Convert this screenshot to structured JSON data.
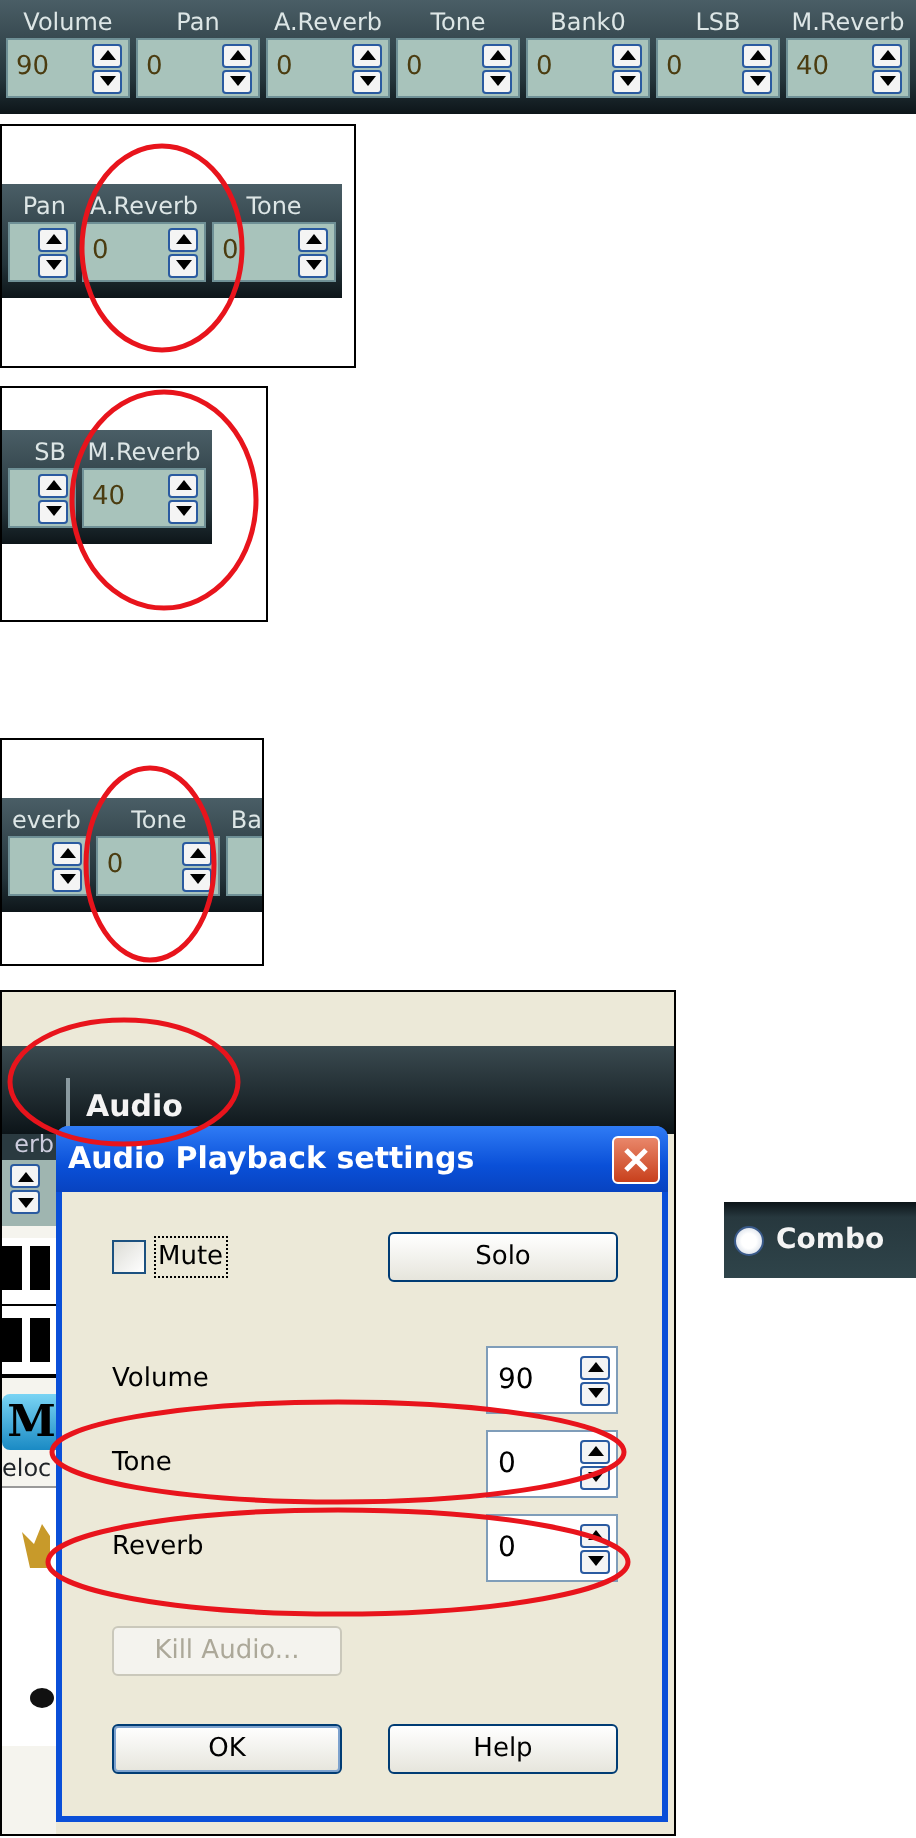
{
  "top_strip": {
    "controls": [
      {
        "kind": "full",
        "label": "Volume",
        "value": "90"
      },
      {
        "kind": "full",
        "label": "Pan",
        "value": "0"
      },
      {
        "kind": "full",
        "label": "A.Reverb",
        "value": "0"
      },
      {
        "kind": "full",
        "label": "Tone",
        "value": "0"
      },
      {
        "kind": "full",
        "label": "Bank0",
        "value": "0"
      },
      {
        "kind": "full",
        "label": "LSB",
        "value": "0"
      },
      {
        "kind": "full",
        "label": "M.Reverb",
        "value": "40"
      }
    ]
  },
  "zoom_callouts": [
    {
      "controls": [
        {
          "kind": "cut-left",
          "label": "Pan"
        },
        {
          "kind": "full",
          "label": "A.Reverb",
          "value": "0"
        },
        {
          "kind": "full",
          "label": "Tone",
          "value": "0"
        }
      ]
    },
    {
      "controls": [
        {
          "kind": "cut-left",
          "label": "SB"
        },
        {
          "kind": "full",
          "label": "M.Reverb",
          "value": "40"
        }
      ]
    },
    {
      "controls": [
        {
          "kind": "cut-left",
          "label": "everb"
        },
        {
          "kind": "full",
          "label": "Tone",
          "value": "0"
        },
        {
          "kind": "cut-right",
          "label": "Ba"
        }
      ]
    }
  ],
  "audio_callout": {
    "section_title": "Audio",
    "side_label": "erb",
    "side_button": "M",
    "side_caption": "eloc",
    "dialog": {
      "title": "Audio Playback settings",
      "mute": {
        "label": "Mute",
        "checked": false
      },
      "solo_button": "Solo",
      "fields": [
        {
          "label": "Volume",
          "value": "90"
        },
        {
          "label": "Tone",
          "value": "0"
        },
        {
          "label": "Reverb",
          "value": "0"
        }
      ],
      "kill_button": {
        "label": "Kill Audio...",
        "disabled": true
      },
      "buttons": [
        "OK",
        "Help"
      ]
    }
  },
  "combo": {
    "label": "Combo",
    "selected": false
  }
}
